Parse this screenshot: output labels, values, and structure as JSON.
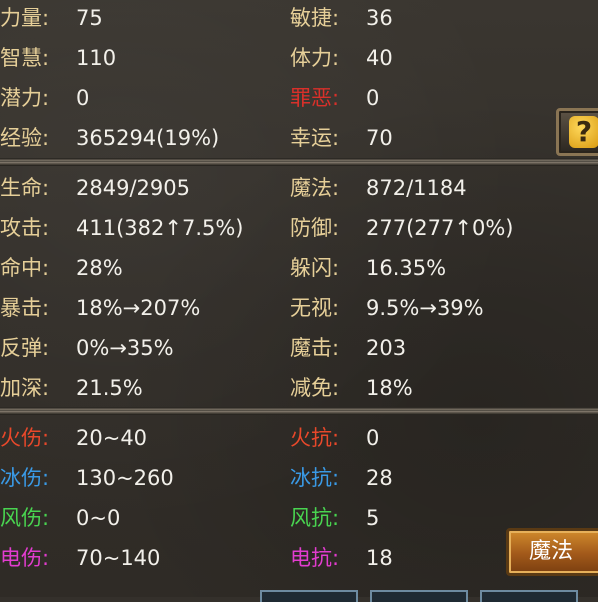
{
  "colors": {
    "label": "#e6cf98",
    "crime": "#d9302a",
    "fire": "#e8482a",
    "ice": "#3a9ae6",
    "wind": "#49d450",
    "electric": "#e23ccf",
    "value": "#f2f0ea"
  },
  "base": [
    {
      "left": {
        "label": "力量:",
        "value": "75"
      },
      "right": {
        "label": "敏捷:",
        "value": "36"
      }
    },
    {
      "left": {
        "label": "智慧:",
        "value": "110"
      },
      "right": {
        "label": "体力:",
        "value": "40"
      }
    },
    {
      "left": {
        "label": "潜力:",
        "value": "0"
      },
      "right": {
        "label": "罪恶:",
        "value": "0"
      }
    },
    {
      "left": {
        "label": "经验:",
        "value": "365294(19%)"
      },
      "right": {
        "label": "幸运:",
        "value": "70"
      }
    }
  ],
  "combat": [
    {
      "left": {
        "label": "生命:",
        "value": "2849/2905"
      },
      "right": {
        "label": "魔法:",
        "value": "872/1184"
      }
    },
    {
      "left": {
        "label": "攻击:",
        "value": "411(382↑7.5%)"
      },
      "right": {
        "label": "防御:",
        "value": "277(277↑0%)"
      }
    },
    {
      "left": {
        "label": "命中:",
        "value": "28%"
      },
      "right": {
        "label": "躲闪:",
        "value": "16.35%"
      }
    },
    {
      "left": {
        "label": "暴击:",
        "value": "18%→207%"
      },
      "right": {
        "label": "无视:",
        "value": "9.5%→39%"
      }
    },
    {
      "left": {
        "label": "反弹:",
        "value": "0%→35%"
      },
      "right": {
        "label": "魔击:",
        "value": "203"
      }
    },
    {
      "left": {
        "label": "加深:",
        "value": "21.5%"
      },
      "right": {
        "label": "减免:",
        "value": "18%"
      }
    }
  ],
  "elemental": [
    {
      "left": {
        "label": "火伤:",
        "value": "20~40"
      },
      "right": {
        "label": "火抗:",
        "value": "0"
      }
    },
    {
      "left": {
        "label": "冰伤:",
        "value": "130~260"
      },
      "right": {
        "label": "冰抗:",
        "value": "28"
      }
    },
    {
      "left": {
        "label": "风伤:",
        "value": "0~0"
      },
      "right": {
        "label": "风抗:",
        "value": "5"
      }
    },
    {
      "left": {
        "label": "电伤:",
        "value": "70~140"
      },
      "right": {
        "label": "电抗:",
        "value": "18"
      }
    }
  ],
  "help_button": {
    "icon": "question-icon",
    "glyph": "?"
  },
  "magic_button": {
    "label": "魔法"
  }
}
